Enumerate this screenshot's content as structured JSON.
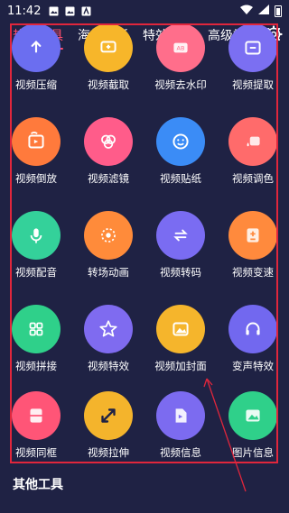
{
  "status": {
    "time": "11:42",
    "icons": [
      "image-icon",
      "image-icon",
      "text-icon"
    ]
  },
  "tabs": [
    {
      "label": "热门工具",
      "active": true
    },
    {
      "label": "海报模板",
      "active": false
    },
    {
      "label": "特效模板",
      "active": false
    },
    {
      "label": "高级模板",
      "active": false
    }
  ],
  "tools": [
    {
      "label": "视频压缩",
      "icon": "compress-icon",
      "color": "#6b6ef0"
    },
    {
      "label": "视频截取",
      "icon": "cut-icon",
      "color": "#f7b62a"
    },
    {
      "label": "视频去水印",
      "icon": "watermark-icon",
      "color": "#ff6e8b"
    },
    {
      "label": "视频提取",
      "icon": "extract-icon",
      "color": "#7b6ff2"
    },
    {
      "label": "视频倒放",
      "icon": "reverse-icon",
      "color": "#ff7a3c"
    },
    {
      "label": "视频滤镜",
      "icon": "filter-icon",
      "color": "#ff5c8a"
    },
    {
      "label": "视频贴纸",
      "icon": "sticker-icon",
      "color": "#3b8cf6"
    },
    {
      "label": "视频调色",
      "icon": "palette-icon",
      "color": "#ff6b6b"
    },
    {
      "label": "视频配音",
      "icon": "microphone-icon",
      "color": "#34d19a"
    },
    {
      "label": "转场动画",
      "icon": "transition-icon",
      "color": "#ff8b3a"
    },
    {
      "label": "视频转码",
      "icon": "convert-icon",
      "color": "#7a6cf2"
    },
    {
      "label": "视频变速",
      "icon": "speed-icon",
      "color": "#ff8a3d"
    },
    {
      "label": "视频拼接",
      "icon": "grid-icon",
      "color": "#2fd08a"
    },
    {
      "label": "视频特效",
      "icon": "star-icon",
      "color": "#7f6bf0"
    },
    {
      "label": "视频加封面",
      "icon": "cover-icon",
      "color": "#f5b52c"
    },
    {
      "label": "变声特效",
      "icon": "headphones-icon",
      "color": "#7268ef"
    },
    {
      "label": "视频同框",
      "icon": "split-screen-icon",
      "color": "#ff5577"
    },
    {
      "label": "视频拉伸",
      "icon": "stretch-icon",
      "color": "#f4b42c"
    },
    {
      "label": "视频信息",
      "icon": "video-file-icon",
      "color": "#7c6bf0"
    },
    {
      "label": "图片信息",
      "icon": "image-icon",
      "color": "#2fd08a"
    }
  ],
  "section": {
    "other_tools": "其他工具"
  },
  "colors": {
    "background": "#1f2244",
    "active_tab": "#ff4d6d",
    "highlight": "#e0263c"
  }
}
